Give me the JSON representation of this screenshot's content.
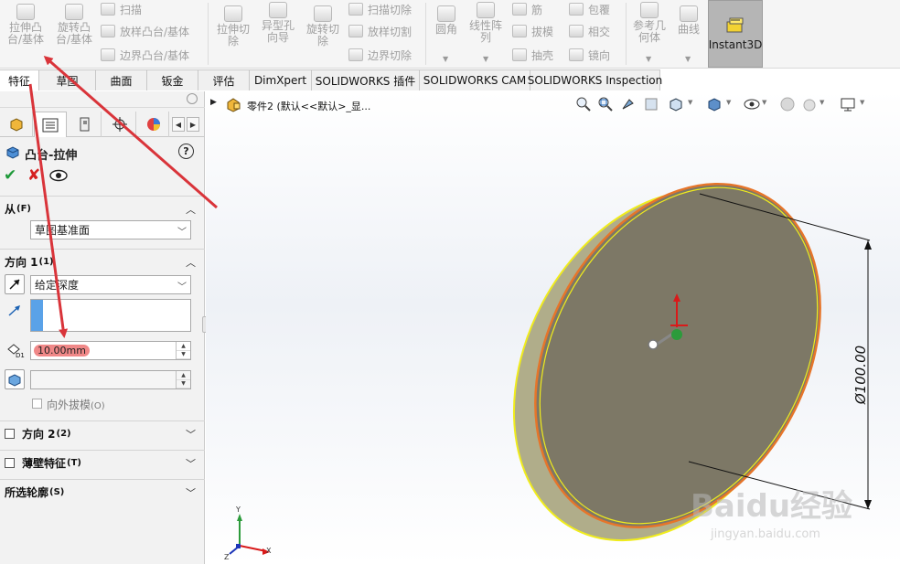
{
  "ribbon": {
    "extrude_boss": "拉伸凸\n台/基体",
    "revolve_boss": "旋转凸\n台/基体",
    "sweep": "扫描",
    "loft": "放样凸台/基体",
    "boundary": "边界凸台/基体",
    "extrude_cut": "拉伸切\n除",
    "hole_wizard": "异型孔\n向导",
    "revolve_cut": "旋转切\n除",
    "swept_cut": "扫描切除",
    "lofted_cut": "放样切割",
    "boundary_cut": "边界切除",
    "fillet": "圆角",
    "linear_pattern": "线性阵\n列",
    "rib": "筋",
    "draft": "拔模",
    "shell": "抽壳",
    "wrap": "包覆",
    "intersect": "相交",
    "mirror": "镜向",
    "ref_geometry": "参考几\n何体",
    "curves": "曲线",
    "instant3d": "Instant3D"
  },
  "tabs": [
    "特征",
    "草图",
    "曲面",
    "钣金",
    "评估",
    "DimXpert",
    "SOLIDWORKS 插件",
    "SOLIDWORKS CAM",
    "SOLIDWORKS Inspection"
  ],
  "panel": {
    "title": "凸台-拉伸",
    "help": "?",
    "from_label": "从",
    "from_key": "(F)",
    "from_value": "草图基准面",
    "dir1_label": "方向 1",
    "dir1_key": "(1)",
    "end_condition": "给定深度",
    "depth": "10.00mm",
    "draft_outward": "向外拔模",
    "draft_key": "(O)",
    "dir2_label": "方向 2",
    "dir2_key": "(2)",
    "thin_label": "薄壁特征",
    "thin_key": "(T)",
    "contours_label": "所选轮廓",
    "contours_key": "(S)"
  },
  "viewport": {
    "breadcrumb": "零件2  (默认<<默认>_显...",
    "dimension": "Ø100.00",
    "triad": {
      "x": "X",
      "y": "Y",
      "z": "Z"
    }
  },
  "colors": {
    "annotation_arrow": "#d9343a",
    "disk_face": "#7d7866",
    "disk_rim": "#b0ad8a",
    "edge_orange": "#e6752a",
    "edge_yellow": "#f0ec1c",
    "depth_highlight": "#f08888"
  },
  "watermark": {
    "brand": "Baidu经验",
    "url": "jingyan.baidu.com"
  }
}
